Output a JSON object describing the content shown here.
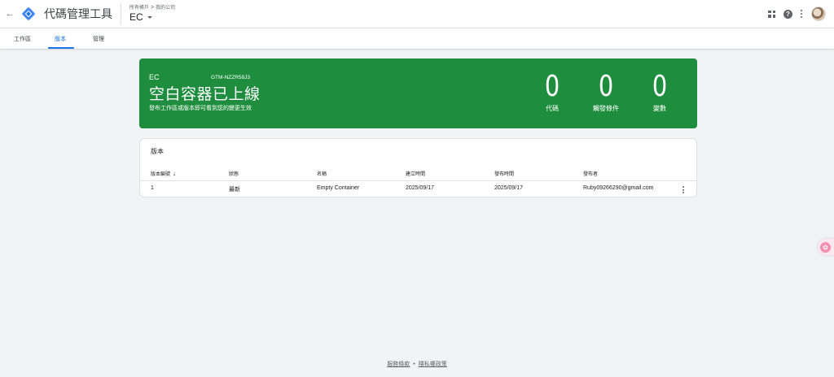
{
  "header": {
    "back_icon": "arrow-back-icon",
    "logo_icon": "gtm-logo-icon",
    "app_title": "代碼管理工具",
    "breadcrumb": {
      "account_root": "所有帳戶",
      "separator": ">",
      "account_name": "我的公司"
    },
    "container_name": "EC",
    "right_icons": [
      "apps-grid-icon",
      "help-icon",
      "more-vert-icon",
      "avatar"
    ]
  },
  "tabs": [
    {
      "label": "工作區",
      "active": false
    },
    {
      "label": "版本",
      "active": true
    },
    {
      "label": "管理",
      "active": false
    }
  ],
  "hero": {
    "container_name": "EC",
    "container_id": "GTM-NZZR58J3",
    "headline": "空白容器已上線",
    "subtitle": "發布工作區或版本即可看到您的變更生效",
    "stats": [
      {
        "value": "0",
        "label": "代碼"
      },
      {
        "value": "0",
        "label": "觸發條件"
      },
      {
        "value": "0",
        "label": "變數"
      }
    ],
    "color": "#1e8e3e"
  },
  "versions": {
    "title": "版本",
    "columns": [
      "版本編號",
      "狀態",
      "名稱",
      "建立時間",
      "發布時間",
      "發布者"
    ],
    "sort_icon": "arrow-downward-icon",
    "rows": [
      {
        "number": "1",
        "status": "最新",
        "name": "Empty Container",
        "created": "2025/09/17",
        "published": "2025/09/17",
        "publisher": "Ruby09266290@gmail.com"
      }
    ]
  },
  "footer": {
    "terms": "服務條款",
    "separator": "•",
    "privacy": "隱私權政策"
  },
  "accent_color": "#1a73e8"
}
